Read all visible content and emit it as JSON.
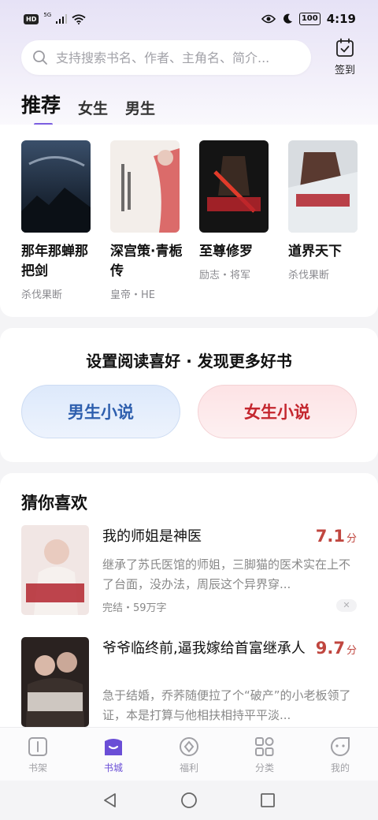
{
  "status_bar": {
    "hd": "HD",
    "network": "5G",
    "battery": "100",
    "time": "4:19"
  },
  "search": {
    "placeholder": "支持搜索书名、作者、主角名、简介..."
  },
  "checkin": {
    "label": "签到"
  },
  "tabs": [
    {
      "label": "推荐",
      "active": true
    },
    {
      "label": "女生",
      "active": false
    },
    {
      "label": "男生",
      "active": false
    }
  ],
  "recommended": [
    {
      "title": "那年那蝉那把剑",
      "tags": "杀伐果断"
    },
    {
      "title": "深宫策·青栀传",
      "tags": "皇帝・HE"
    },
    {
      "title": "至尊修罗",
      "tags": "励志・将军"
    },
    {
      "title": "道界天下",
      "tags": "杀伐果断"
    }
  ],
  "preference": {
    "title": "设置阅读喜好 · 发现更多好书",
    "male_label": "男生小说",
    "female_label": "女生小说"
  },
  "guess": {
    "title": "猜你喜欢",
    "items": [
      {
        "title": "我的师姐是神医",
        "score": "7.1",
        "score_unit": "分",
        "desc": "继承了苏氏医馆的师姐，三脚猫的医术实在上不了台面，没办法，周辰这个异界穿...",
        "meta": "完结・59万字",
        "close": "✕"
      },
      {
        "title": "爷爷临终前,逼我嫁给首富继承人",
        "score": "9.7",
        "score_unit": "分",
        "desc": "急于结婚，乔荞随便拉了个“破产”的小老板领了证，本是打算与他相扶相持平平淡..."
      }
    ]
  },
  "bottom_nav": [
    {
      "label": "书架",
      "icon": "bookshelf-icon",
      "active": false
    },
    {
      "label": "书城",
      "icon": "bookstore-icon",
      "active": true
    },
    {
      "label": "福利",
      "icon": "coin-icon",
      "active": false
    },
    {
      "label": "分类",
      "icon": "category-icon",
      "active": false
    },
    {
      "label": "我的",
      "icon": "profile-icon",
      "active": false
    }
  ],
  "colors": {
    "accent": "#6a4ed6",
    "score": "#c0463f",
    "male": "#2e5fae",
    "female": "#c4262e"
  }
}
